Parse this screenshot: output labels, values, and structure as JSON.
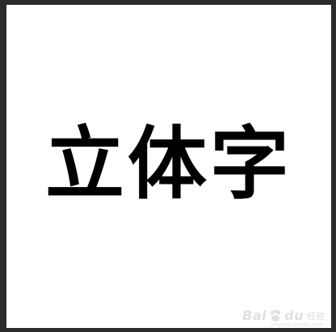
{
  "canvas": {
    "headline": "立体字",
    "background_color": "#ffffff",
    "text_color": "#000000"
  },
  "frame": {
    "background_color": "#2b2b2b"
  },
  "watermark": {
    "brand": "Bai",
    "brand_suffix": "du",
    "product": "经验",
    "url": "jingyan.baidu.com",
    "icon": "baidu-paw-icon"
  }
}
